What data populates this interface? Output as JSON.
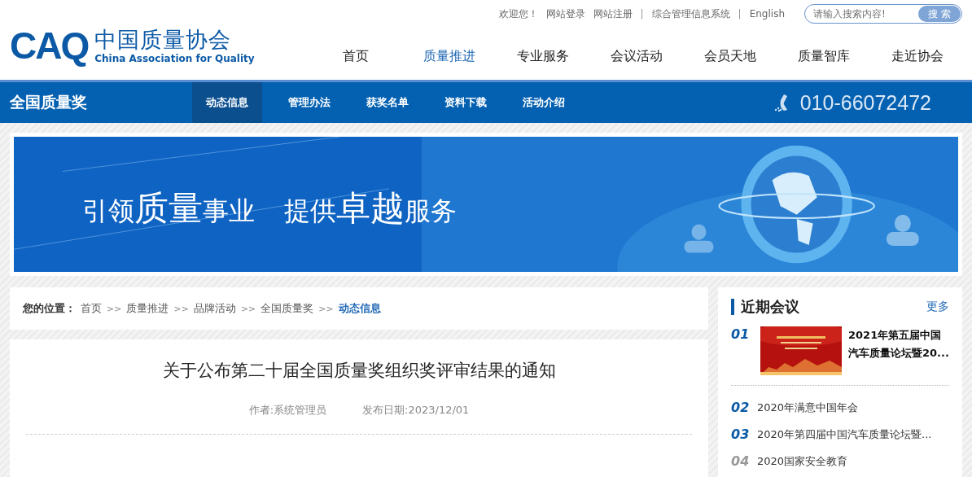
{
  "top_links": [
    {
      "kind": "text",
      "label": "欢迎您！"
    },
    {
      "kind": "link",
      "label": "网站登录"
    },
    {
      "kind": "link",
      "label": "网站注册"
    },
    {
      "kind": "separator",
      "label": "|"
    },
    {
      "kind": "link",
      "label": "综合管理信息系统"
    },
    {
      "kind": "separator",
      "label": "|"
    },
    {
      "kind": "link",
      "label": "English"
    }
  ],
  "search": {
    "placeholder": "请输入搜索内容!",
    "button": "搜 索"
  },
  "logo": {
    "mark": "CAQ",
    "name": "中国质量协会",
    "english": "China Association for Quality"
  },
  "main_nav": [
    {
      "label": "首页",
      "selected": false
    },
    {
      "label": "质量推进",
      "selected": true
    },
    {
      "label": "专业服务",
      "selected": false
    },
    {
      "label": "会议活动",
      "selected": false
    },
    {
      "label": "会员天地",
      "selected": false
    },
    {
      "label": "质量智库",
      "selected": false
    },
    {
      "label": "走近协会",
      "selected": false
    }
  ],
  "sub_nav": {
    "title": "全国质量奖",
    "phone": "010-66072472",
    "items": [
      {
        "label": "动态信息",
        "selected": true
      },
      {
        "label": "管理办法",
        "selected": false
      },
      {
        "label": "获奖名单",
        "selected": false
      },
      {
        "label": "资料下载",
        "selected": false
      },
      {
        "label": "活动介绍",
        "selected": false
      }
    ]
  },
  "banner": {
    "slogan": [
      {
        "text": "引领",
        "emphasis": false
      },
      {
        "text": "质量",
        "emphasis": true
      },
      {
        "text": "事业",
        "emphasis": false
      },
      {
        "text": "提供",
        "emphasis": false
      },
      {
        "text": "卓越",
        "emphasis": true
      },
      {
        "text": "服务",
        "emphasis": false
      }
    ]
  },
  "breadcrumb": {
    "label": "您的位置：",
    "items": [
      {
        "label": "首页",
        "selected": false
      },
      {
        "label": "质量推进",
        "selected": false
      },
      {
        "label": "品牌活动",
        "selected": false
      },
      {
        "label": "全国质量奖",
        "selected": false
      },
      {
        "label": "动态信息",
        "selected": true
      }
    ],
    "separator": ">>"
  },
  "article": {
    "title": "关于公布第二十届全国质量奖组织奖评审结果的通知",
    "author": "作者:系统管理员",
    "date": "发布日期:2023/12/01"
  },
  "sidebar": {
    "title": "近期会议",
    "more": "更多",
    "items": [
      {
        "number": "01",
        "title": "2021年第五届中国汽车质量论坛暨20...",
        "kind": "featured",
        "highlight": true
      },
      {
        "number": "02",
        "title": "2020年满意中国年会",
        "kind": "plain",
        "highlight": true
      },
      {
        "number": "03",
        "title": "2020年第四届中国汽车质量论坛暨...",
        "kind": "plain",
        "highlight": true
      },
      {
        "number": "04",
        "title": "2020国家安全教育",
        "kind": "plain",
        "highlight": false
      }
    ]
  }
}
